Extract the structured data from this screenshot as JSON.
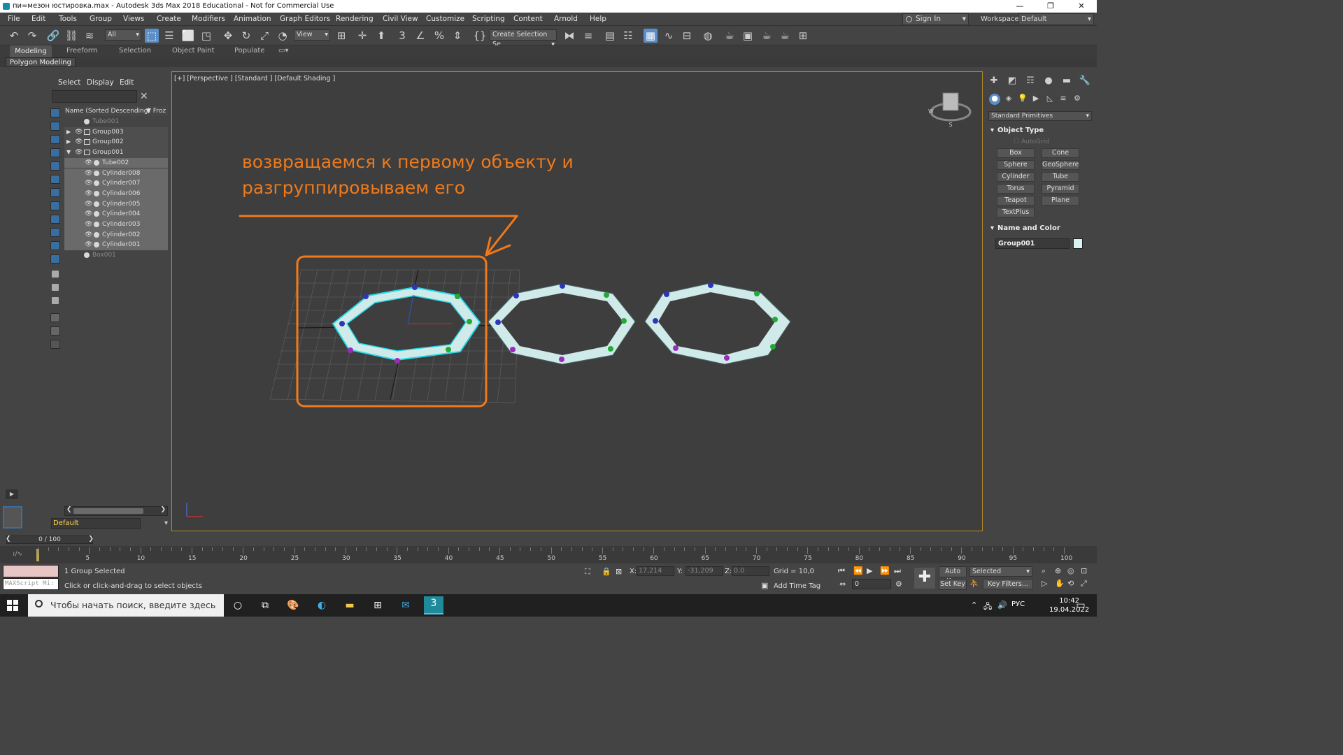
{
  "window": {
    "title": "пи=мезон юстировка.max - Autodesk 3ds Max 2018 Educational - Not for Commercial Use"
  },
  "menu": [
    "File",
    "Edit",
    "Tools",
    "Group",
    "Views",
    "Create",
    "Modifiers",
    "Animation",
    "Graph Editors",
    "Rendering",
    "Civil View",
    "Customize",
    "Scripting",
    "Content",
    "Arnold",
    "Help"
  ],
  "account": {
    "sign_in": "Sign In",
    "workspaces_label": "Workspaces:",
    "workspace": "Default"
  },
  "toolbar": {
    "filter": "All",
    "view": "View",
    "selection_set": "Create Selection Se"
  },
  "ribbon": {
    "tabs": [
      "Modeling",
      "Freeform",
      "Selection",
      "Object Paint",
      "Populate"
    ],
    "sub": "Polygon Modeling"
  },
  "explorer": {
    "tabs": [
      "Select",
      "Display",
      "Edit"
    ],
    "column": "Name (Sorted Descending)",
    "frozen_col": "▼ Froz",
    "rows": [
      {
        "name": "Tube001",
        "level": 0,
        "type": "obj",
        "state": "dim"
      },
      {
        "name": "Group003",
        "level": 0,
        "type": "grp",
        "state": "collapsed"
      },
      {
        "name": "Group002",
        "level": 0,
        "type": "grp",
        "state": "collapsed"
      },
      {
        "name": "Group001",
        "level": 0,
        "type": "grp",
        "state": "expanded"
      },
      {
        "name": "Tube002",
        "level": 1,
        "type": "obj",
        "state": "sel"
      },
      {
        "name": "Cylinder008",
        "level": 1,
        "type": "obj",
        "state": "sel"
      },
      {
        "name": "Cylinder007",
        "level": 1,
        "type": "obj",
        "state": "sel"
      },
      {
        "name": "Cylinder006",
        "level": 1,
        "type": "obj",
        "state": "sel"
      },
      {
        "name": "Cylinder005",
        "level": 1,
        "type": "obj",
        "state": "sel"
      },
      {
        "name": "Cylinder004",
        "level": 1,
        "type": "obj",
        "state": "sel"
      },
      {
        "name": "Cylinder003",
        "level": 1,
        "type": "obj",
        "state": "sel"
      },
      {
        "name": "Cylinder002",
        "level": 1,
        "type": "obj",
        "state": "sel"
      },
      {
        "name": "Cylinder001",
        "level": 1,
        "type": "obj",
        "state": "sel"
      },
      {
        "name": "Box001",
        "level": 0,
        "type": "obj",
        "state": "dim"
      }
    ],
    "layer": "Default"
  },
  "viewport": {
    "label": "[+] [Perspective ] [Standard ] [Default Shading ]",
    "annotation_line1": "возвращаемся к первому объекту и",
    "annotation_line2": "разгруппировываем его",
    "annotation_color": "#f07a1a"
  },
  "command_panel": {
    "category": "Standard Primitives",
    "object_type_title": "Object Type",
    "autogrid": "AutoGrid",
    "buttons": [
      "Box",
      "Cone",
      "Sphere",
      "GeoSphere",
      "Cylinder",
      "Tube",
      "Torus",
      "Pyramid",
      "Teapot",
      "Plane",
      "TextPlus"
    ],
    "name_color_title": "Name and Color",
    "object_name": "Group001",
    "object_color": "#d9f3f3"
  },
  "timeline": {
    "frame": "0 / 100",
    "ticks": [
      "5",
      "10",
      "15",
      "20",
      "25",
      "30",
      "35",
      "40",
      "45",
      "50",
      "55",
      "60",
      "65",
      "70",
      "75",
      "80",
      "85",
      "90",
      "95",
      "100"
    ]
  },
  "status": {
    "maxscript": "MAXScript Mi:",
    "selected": "1 Group Selected",
    "prompt": "Click or click-and-drag to select objects",
    "x_label": "X:",
    "x": "17,214",
    "y_label": "Y:",
    "y": "-31,209",
    "z_label": "Z:",
    "z": "0,0",
    "grid": "Grid = 10,0",
    "add_time_tag": "Add Time Tag",
    "auto_key": "Auto Key",
    "set_key": "Set Key",
    "key_mode": "Selected",
    "key_filters": "Key Filters...",
    "current_frame": "0"
  },
  "taskbar": {
    "search": "Чтобы начать поиск, введите здесь",
    "lang": "РУС",
    "time": "10:42",
    "date": "19.04.2022"
  }
}
